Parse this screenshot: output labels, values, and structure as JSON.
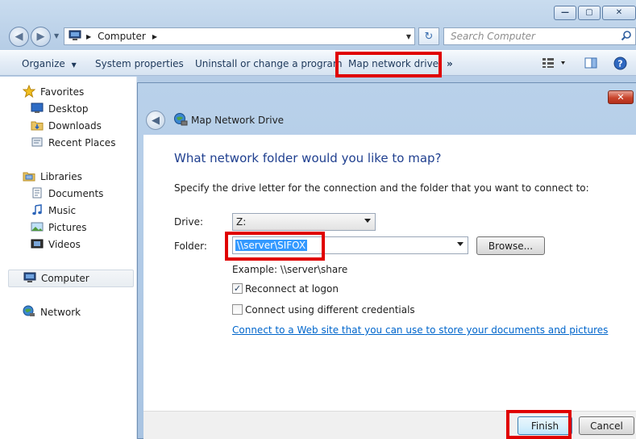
{
  "window": {
    "caption_min": "—",
    "caption_max": "▢",
    "caption_close": "✕"
  },
  "address_bar": {
    "crumbs": [
      "Computer"
    ],
    "search_placeholder": "Search Computer"
  },
  "command_bar": {
    "organize": "Organize",
    "system_properties": "System properties",
    "uninstall": "Uninstall or change a program",
    "map_network_drive": "Map network drive",
    "more": "»"
  },
  "nav_pane": {
    "favorites": {
      "label": "Favorites",
      "items": [
        "Desktop",
        "Downloads",
        "Recent Places"
      ]
    },
    "libraries": {
      "label": "Libraries",
      "items": [
        "Documents",
        "Music",
        "Pictures",
        "Videos"
      ]
    },
    "computer": "Computer",
    "network": "Network"
  },
  "dialog": {
    "title": "Map Network Drive",
    "heading": "What network folder would you like to map?",
    "instruction": "Specify the drive letter for the connection and the folder that you want to connect to:",
    "drive_label": "Drive:",
    "drive_value": "Z:",
    "folder_label": "Folder:",
    "folder_value": "\\\\server\\SIFOX",
    "browse": "Browse...",
    "example": "Example: \\\\server\\share",
    "reconnect_label": "Reconnect at logon",
    "reconnect_checked": true,
    "diff_creds_label": "Connect using different credentials",
    "diff_creds_checked": false,
    "link_text": "Connect to a Web site that you can use to store your documents and pictures",
    "link_suffix": ".",
    "finish": "Finish",
    "cancel": "Cancel"
  },
  "colors": {
    "highlight_box": "#e00000",
    "heading_blue": "#1f3f8f",
    "link_blue": "#0066cc",
    "selection_blue": "#3399ff"
  }
}
